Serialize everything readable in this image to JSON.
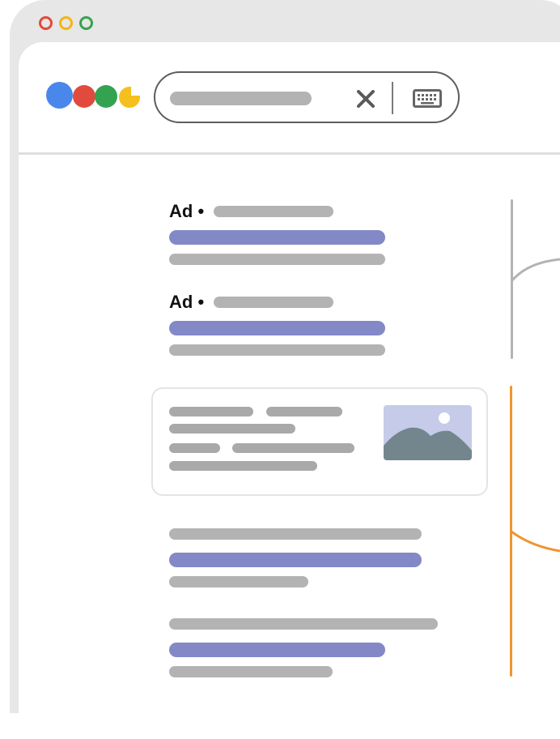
{
  "window": {
    "controls": [
      "close",
      "minimize",
      "maximize"
    ],
    "control_colors": [
      "#e24a3b",
      "#f3b517",
      "#37a24f"
    ]
  },
  "logo": {
    "icon": "google-logo-icon",
    "colors": [
      "#4a87ea",
      "#e04b3d",
      "#33a352",
      "#f5c01e"
    ]
  },
  "search": {
    "value": "",
    "clear_icon": "close-icon",
    "keyboard_icon": "keyboard-icon"
  },
  "results": {
    "ads": [
      {
        "label": "Ad •"
      },
      {
        "label": "Ad •"
      }
    ],
    "image_card_icon": "landscape-image-icon"
  },
  "annotation_colors": {
    "ads_bracket": "#b3b3b3",
    "organic_bracket": "#f0952e",
    "link": "#8289c6"
  }
}
